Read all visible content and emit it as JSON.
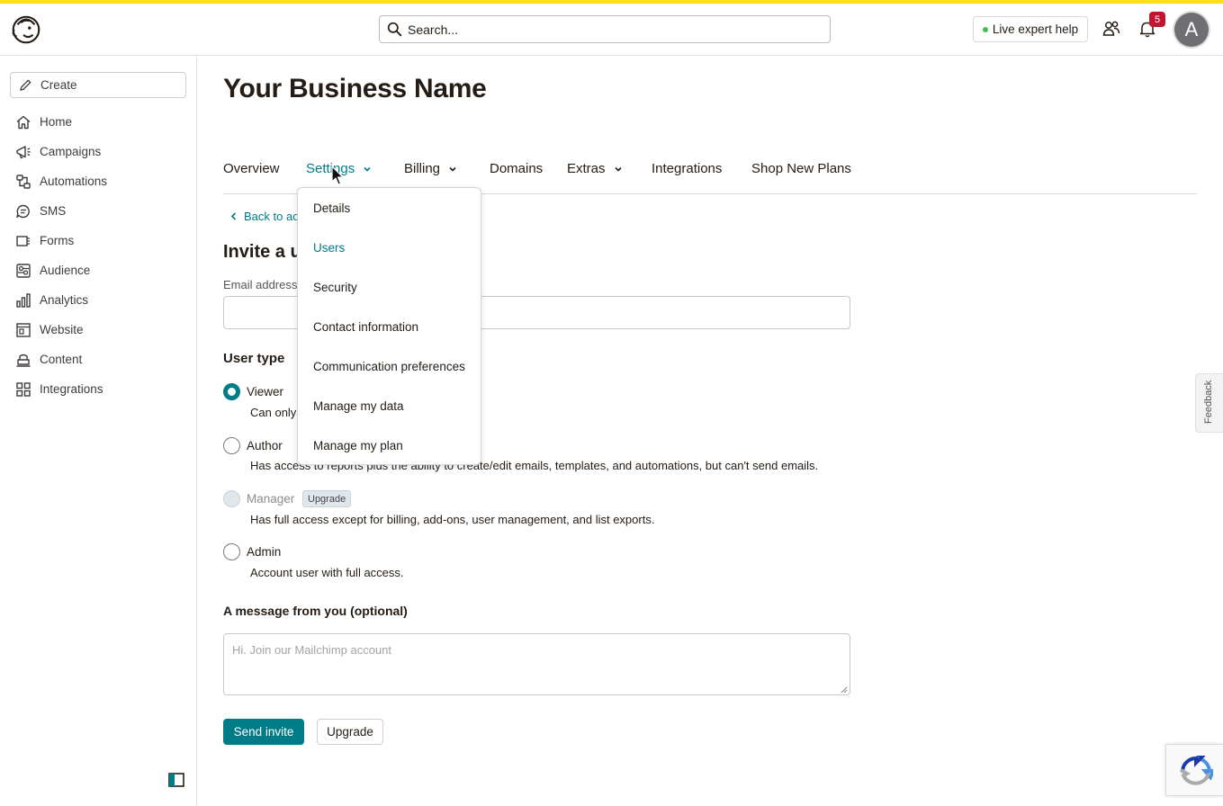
{
  "header": {
    "search_placeholder": "Search...",
    "live_help_label": "Live expert help",
    "notification_count": "5",
    "avatar_initial": "A"
  },
  "sidebar": {
    "create_label": "Create",
    "items": [
      {
        "label": "Home",
        "icon": "home-icon"
      },
      {
        "label": "Campaigns",
        "icon": "megaphone-icon"
      },
      {
        "label": "Automations",
        "icon": "automation-icon"
      },
      {
        "label": "SMS",
        "icon": "sms-icon"
      },
      {
        "label": "Forms",
        "icon": "forms-icon"
      },
      {
        "label": "Audience",
        "icon": "audience-icon"
      },
      {
        "label": "Analytics",
        "icon": "analytics-icon"
      },
      {
        "label": "Website",
        "icon": "website-icon"
      },
      {
        "label": "Content",
        "icon": "content-icon"
      },
      {
        "label": "Integrations",
        "icon": "integrations-icon"
      }
    ]
  },
  "page": {
    "title": "Your Business Name"
  },
  "tabs": [
    {
      "label": "Overview",
      "has_chevron": false,
      "active": false
    },
    {
      "label": "Settings",
      "has_chevron": true,
      "active": true
    },
    {
      "label": "Billing",
      "has_chevron": true,
      "active": false
    },
    {
      "label": "Domains",
      "has_chevron": false,
      "active": false
    },
    {
      "label": "Extras",
      "has_chevron": true,
      "active": false
    },
    {
      "label": "Integrations",
      "has_chevron": false,
      "active": false
    },
    {
      "label": "Shop New Plans",
      "has_chevron": false,
      "active": false
    }
  ],
  "settings_menu": {
    "items": [
      {
        "label": "Details",
        "active": false
      },
      {
        "label": "Users",
        "active": true
      },
      {
        "label": "Security",
        "active": false
      },
      {
        "label": "Contact information",
        "active": false
      },
      {
        "label": "Communication preferences",
        "active": false
      },
      {
        "label": "Manage my data",
        "active": false
      },
      {
        "label": "Manage my plan",
        "active": false
      }
    ]
  },
  "invite_form": {
    "back_link": "Back to ac",
    "section_title": "Invite a u",
    "email_label": "Email address",
    "email_value": "",
    "user_type_label": "User type",
    "options": [
      {
        "label": "Viewer",
        "description": "Can only",
        "selected": true,
        "disabled": false
      },
      {
        "label": "Author",
        "description": "Has access to reports plus the ability to create/edit emails, templates, and automations, but can't send emails.",
        "selected": false,
        "disabled": false
      },
      {
        "label": "Manager",
        "description": "Has full access except for billing, add-ons, user management, and list exports.",
        "selected": false,
        "disabled": true,
        "badge": "Upgrade"
      },
      {
        "label": "Admin",
        "description": "Account user with full access.",
        "selected": false,
        "disabled": false
      }
    ],
    "message_label": "A message from you (optional)",
    "message_placeholder": "Hi. Join our Mailchimp account",
    "send_label": "Send invite",
    "upgrade_label": "Upgrade"
  },
  "feedback_label": "Feedback",
  "colors": {
    "accent": "#007c89",
    "top_stripe": "#ffe01b",
    "notification_badge": "#c41530"
  }
}
